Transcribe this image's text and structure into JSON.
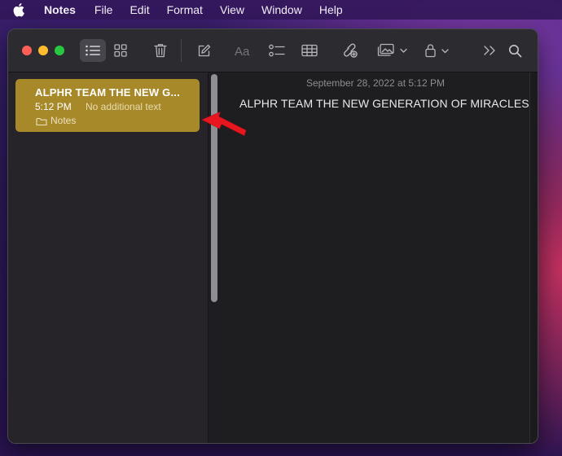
{
  "menubar": {
    "app_name": "Notes",
    "items": [
      "File",
      "Edit",
      "Format",
      "View",
      "Window",
      "Help"
    ]
  },
  "toolbar": {
    "buttons": [
      "list-view-icon",
      "gallery-view-icon",
      "trash-icon",
      "compose-icon",
      "format-text-icon",
      "checklist-icon",
      "table-icon",
      "collaborate-icon",
      "media-icon",
      "lock-icon",
      "more-icon",
      "search-icon"
    ],
    "active_view": "list"
  },
  "sidebar": {
    "notes": [
      {
        "title": "ALPHR TEAM THE NEW G...",
        "time": "5:12 PM",
        "preview": "No additional text",
        "folder": "Notes",
        "selected": true
      }
    ]
  },
  "editor": {
    "date": "September 28, 2022 at 5:12 PM",
    "body": "ALPHR TEAM THE NEW GENERATION OF MIRACLES"
  },
  "colors": {
    "selected_note": "#a8892a",
    "arrow": "#e8161e",
    "window_bg": "#1f1e22"
  }
}
